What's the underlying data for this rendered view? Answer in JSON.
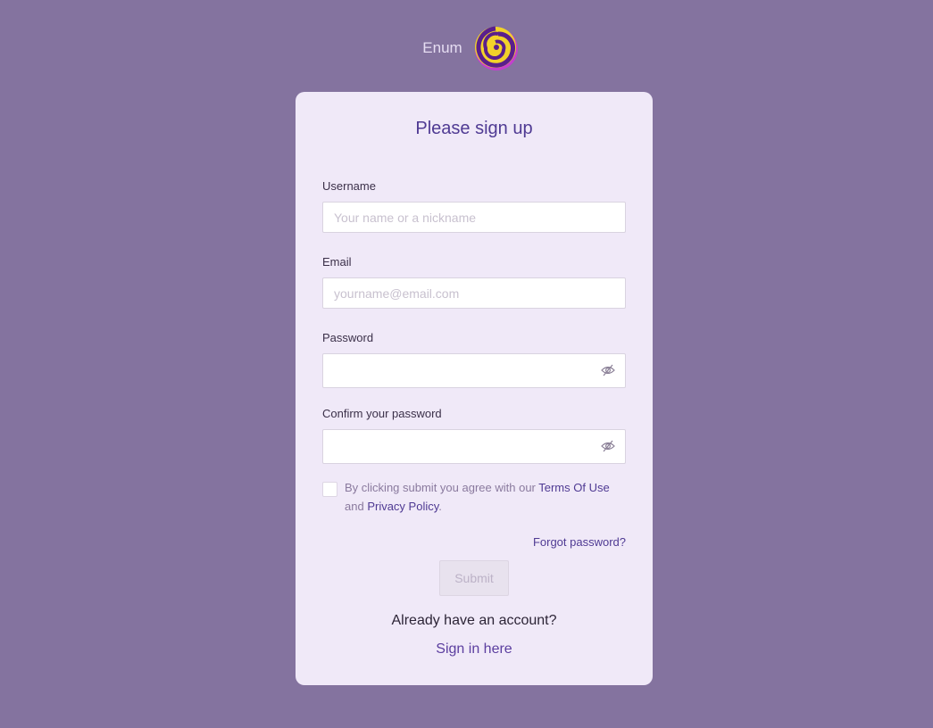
{
  "brand": {
    "name": "Enum",
    "logo_icon": "spiral-logo-icon"
  },
  "form": {
    "title": "Please sign up",
    "username": {
      "label": "Username",
      "placeholder": "Your name or a nickname",
      "value": ""
    },
    "email": {
      "label": "Email",
      "placeholder": "yourname@email.com",
      "value": ""
    },
    "password": {
      "label": "Password",
      "value": "",
      "toggle_icon": "eye-slash-icon"
    },
    "confirm_password": {
      "label": "Confirm your password",
      "value": "",
      "toggle_icon": "eye-slash-icon"
    },
    "consent": {
      "checked": false,
      "text_before": "By clicking submit you agree with our ",
      "terms_link": "Terms Of Use",
      "text_middle": " and ",
      "privacy_link": "Privacy Policy",
      "text_after": "."
    },
    "forgot_password": "Forgot password?",
    "submit_label": "Submit",
    "already_text": "Already have an account?",
    "signin_link": "Sign in here"
  },
  "colors": {
    "background": "#84739f",
    "card": "#f0e9f8",
    "accent": "#4f3a93"
  }
}
